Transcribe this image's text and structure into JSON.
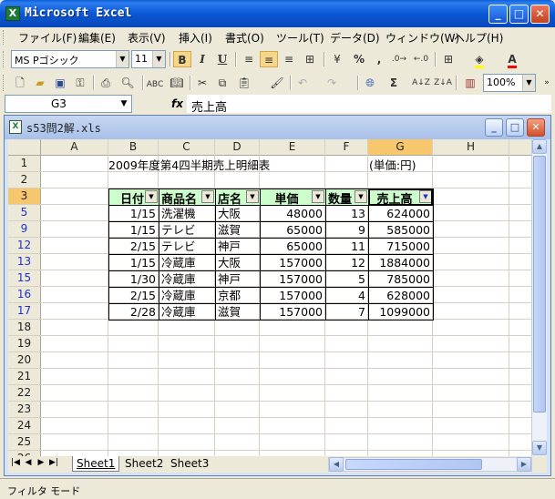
{
  "app": {
    "title": "Microsoft Excel",
    "icon_letter": "X",
    "minimize_icon": "minimize-icon",
    "maximize_icon": "maximize-icon",
    "close_icon": "close-icon"
  },
  "menu": [
    "ファイル(F)",
    "編集(E)",
    "表示(V)",
    "挿入(I)",
    "書式(O)",
    "ツール(T)",
    "データ(D)",
    "ウィンドウ(W)",
    "ヘルプ(H)"
  ],
  "format_toolbar": {
    "font_name": "MS Pゴシック",
    "font_size": "11",
    "bold": "B",
    "italic": "I",
    "underline": "U",
    "percent": "%",
    "comma": ",",
    "accent_fill": "#ffff00",
    "accent_font": "#ff0000"
  },
  "standard_toolbar": {
    "zoom": "100%",
    "sum": "Σ"
  },
  "formula_bar": {
    "name_box": "G3",
    "fx": "fx",
    "content": "売上高"
  },
  "workbook": {
    "title": "s53問2解.xls"
  },
  "columns": [
    "A",
    "B",
    "C",
    "D",
    "E",
    "F",
    "G",
    "H",
    "I"
  ],
  "rows": [
    "1",
    "2",
    "3",
    "5",
    "9",
    "12",
    "13",
    "15",
    "16",
    "17",
    "18",
    "19",
    "20",
    "21",
    "22",
    "23",
    "24",
    "25",
    "26"
  ],
  "sheet": {
    "title": "2009年度第4四半期売上明細表",
    "unit": "(単価:円)",
    "headers": [
      "日付",
      "商品名",
      "店名",
      "単価",
      "数量",
      "売上高"
    ],
    "records": [
      [
        "1/15",
        "洗濯機",
        "大阪",
        "48000",
        "13",
        "624000"
      ],
      [
        "1/15",
        "テレビ",
        "滋賀",
        "65000",
        "9",
        "585000"
      ],
      [
        "2/15",
        "テレビ",
        "神戸",
        "65000",
        "11",
        "715000"
      ],
      [
        "1/15",
        "冷蔵庫",
        "大阪",
        "157000",
        "12",
        "1884000"
      ],
      [
        "1/30",
        "冷蔵庫",
        "神戸",
        "157000",
        "5",
        "785000"
      ],
      [
        "2/15",
        "冷蔵庫",
        "京都",
        "157000",
        "4",
        "628000"
      ],
      [
        "2/28",
        "冷蔵庫",
        "滋賀",
        "157000",
        "7",
        "1099000"
      ]
    ],
    "filtered_row_color": "#1f2fd0",
    "header_fill": "#ccffcc"
  },
  "sheet_tabs": [
    "Sheet1",
    "Sheet2",
    "Sheet3"
  ],
  "status": "フィルタ モード"
}
